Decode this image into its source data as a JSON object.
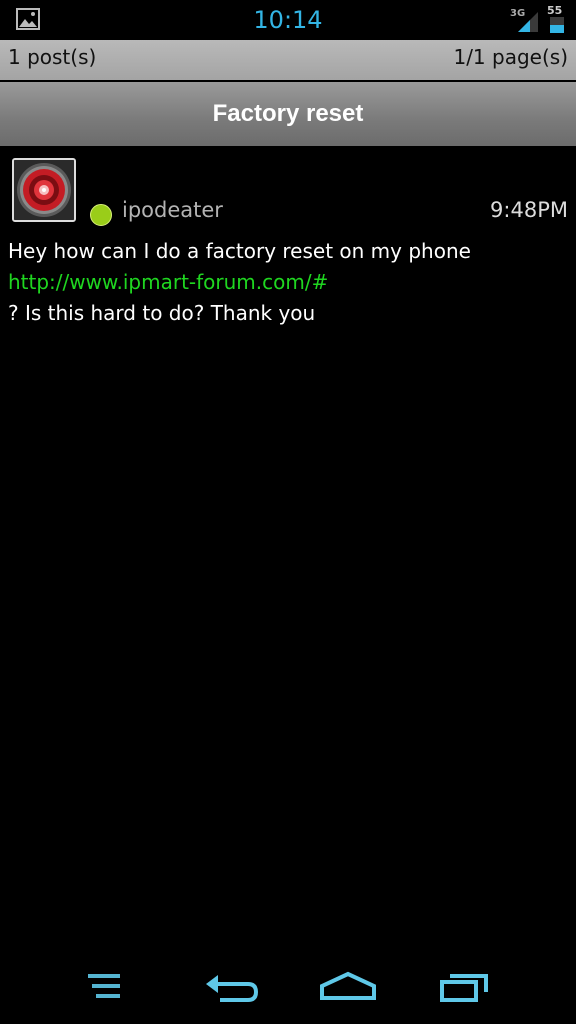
{
  "status_bar": {
    "time": "10:14",
    "network": "3G",
    "battery_level": "55",
    "accent_color": "#33b5e5",
    "icons": [
      "image-notification-icon",
      "signal-icon",
      "battery-icon"
    ]
  },
  "pagination": {
    "posts": "1 post(s)",
    "pages": "1/1 page(s)"
  },
  "thread": {
    "title": "Factory reset"
  },
  "post": {
    "username": "ipodeater",
    "time": "9:48PM",
    "online_status_color": "#9acd19",
    "body_line1": "Hey how can I do a factory reset on my phone",
    "link": "http://www.ipmart-forum.com/#",
    "body_line2": "? Is this hard to do? Thank you"
  },
  "nav_bar": {
    "icons": [
      "menu-icon",
      "back-icon",
      "home-icon",
      "recent-apps-icon"
    ]
  }
}
